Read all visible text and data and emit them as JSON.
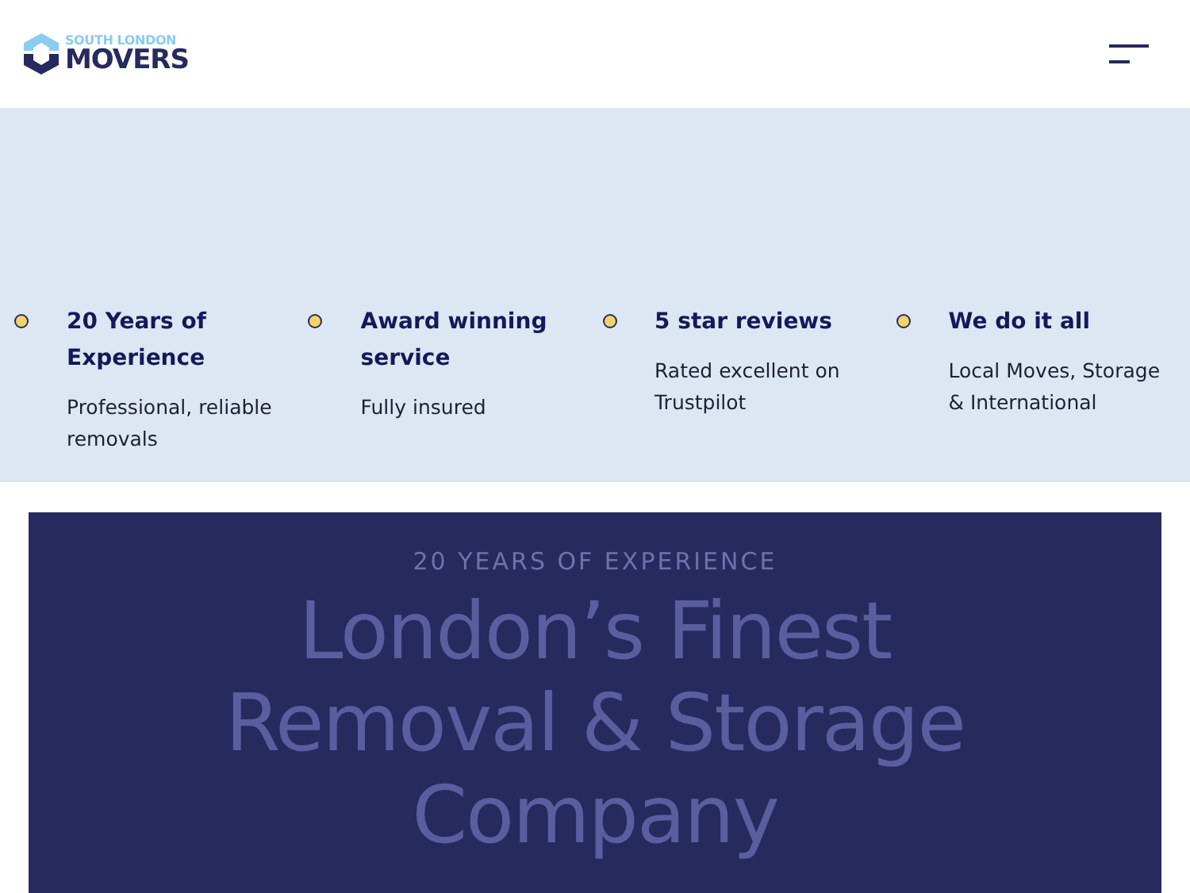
{
  "header": {
    "logo": {
      "top_line": "SOUTH LONDON",
      "main_line": "MOVERS"
    }
  },
  "features": [
    {
      "title": "20 Years of Experience",
      "text": "Professional, reliable removals"
    },
    {
      "title": "Award winning service",
      "text": "Fully insured"
    },
    {
      "title": "5 star reviews",
      "text": "Rated excellent on Trustpilot"
    },
    {
      "title": "We do it all",
      "text": "Local Moves, Storage & International"
    }
  ],
  "hero": {
    "eyebrow": "20 YEARS OF EXPERIENCE",
    "headline": "London’s Finest Removal & Storage Company"
  }
}
